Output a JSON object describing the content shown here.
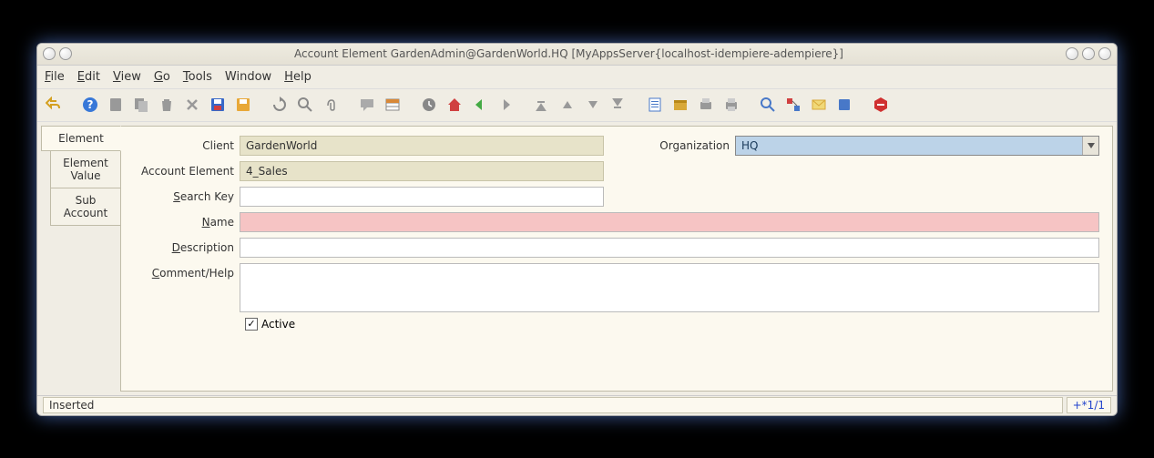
{
  "window": {
    "title": "Account Element  GardenAdmin@GardenWorld.HQ [MyAppsServer{localhost-idempiere-adempiere}]"
  },
  "menu": {
    "file": "File",
    "edit": "Edit",
    "view": "View",
    "go": "Go",
    "tools": "Tools",
    "window": "Window",
    "help": "Help"
  },
  "tabs": {
    "element": "Element",
    "element_value": "Element Value",
    "sub_account": "Sub Account"
  },
  "form": {
    "client_label": "Client",
    "client_value": "GardenWorld",
    "org_label": "Organization",
    "org_value": "HQ",
    "account_element_label": "Account Element",
    "account_element_value": "4_Sales",
    "search_key_label": "Search Key",
    "search_key_value": "",
    "name_label": "Name",
    "name_value": "",
    "description_label": "Description",
    "description_value": "",
    "comment_label": "Comment/Help",
    "comment_value": "",
    "active_label": "Active",
    "active_checked": true
  },
  "status": {
    "left": "Inserted",
    "right": "+*1/1"
  }
}
